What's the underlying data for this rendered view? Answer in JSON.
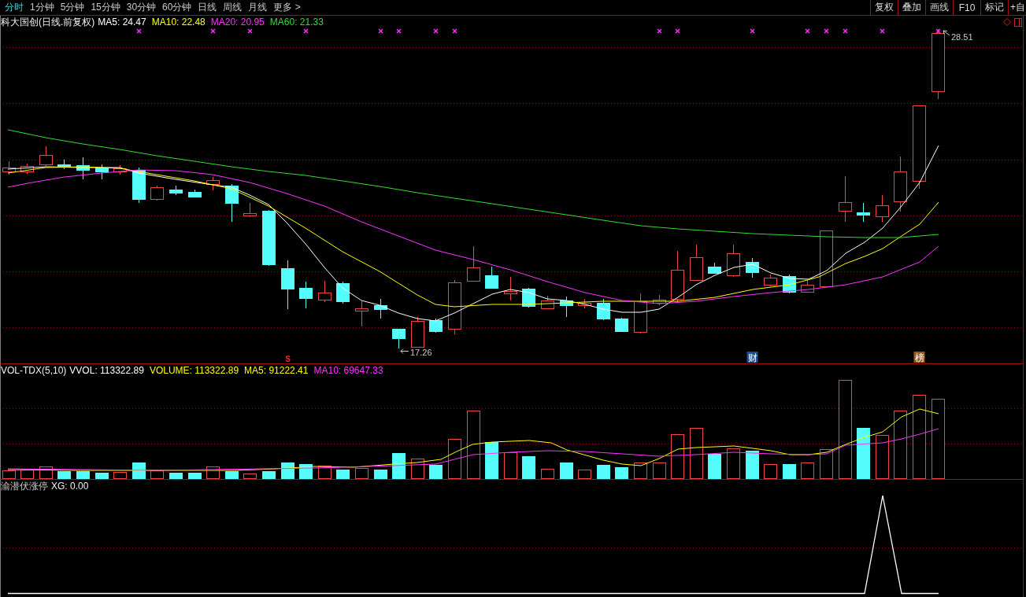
{
  "toolbar": {
    "periods": [
      {
        "label": "分时",
        "selected": true
      },
      {
        "label": "1分钟",
        "selected": false
      },
      {
        "label": "5分钟",
        "selected": false
      },
      {
        "label": "15分钟",
        "selected": false
      },
      {
        "label": "30分钟",
        "selected": false
      },
      {
        "label": "60分钟",
        "selected": false
      },
      {
        "label": "日线",
        "selected": false
      },
      {
        "label": "周线",
        "selected": false
      },
      {
        "label": "月线",
        "selected": false
      },
      {
        "label": "更多 >",
        "selected": false
      }
    ],
    "tools": [
      "复权",
      "叠加",
      "画线",
      "F10",
      "标记",
      "+自"
    ]
  },
  "price_panel": {
    "title": "科大国创(日线.前复权)",
    "averages": [
      {
        "label": "MA5: 24.47",
        "color": "#ffffff"
      },
      {
        "label": "MA10: 22.48",
        "color": "#ffff00"
      },
      {
        "label": "MA20: 20.95",
        "color": "#ff33ff"
      },
      {
        "label": "MA60: 21.33",
        "color": "#33dd33"
      }
    ],
    "high_label": "28.51",
    "low_label": "17.26",
    "event_marks": [
      {
        "kind": "letter",
        "label": "S",
        "color": "#ff2020"
      },
      {
        "kind": "badge",
        "label": "财",
        "color": "#1f4f8f"
      },
      {
        "kind": "badge",
        "label": "榜",
        "color": "#9a5a1a"
      }
    ]
  },
  "volume_panel": {
    "title": "VOL-TDX(5,10)",
    "values": [
      {
        "label": "VVOL: 113322.89",
        "color": "#ffffff"
      },
      {
        "label": "VOLUME: 113322.89",
        "color": "#ffff00"
      },
      {
        "label": "MA5: 91222.41",
        "color": "#ffff00"
      },
      {
        "label": "MA10: 69647.33",
        "color": "#ff33ff"
      }
    ]
  },
  "signal_panel": {
    "title": "渝潜伏涨停",
    "value": "XG: 0.00"
  }
}
